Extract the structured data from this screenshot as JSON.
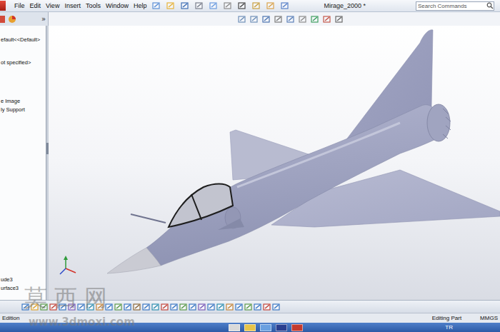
{
  "window": {
    "title": "Mirage_2000 *"
  },
  "menu": [
    "File",
    "Edit",
    "View",
    "Insert",
    "Tools",
    "Window",
    "Help"
  ],
  "search": {
    "placeholder": "Search Commands"
  },
  "panel": {
    "expand": "»"
  },
  "tree": {
    "groups": [
      [
        "efault<<Default>"
      ],
      [
        "ot specified>"
      ],
      [
        "e Image",
        "ly Support"
      ],
      [
        "ude3",
        "urface3"
      ]
    ]
  },
  "status_bar": {
    "left": "Edition",
    "mode": "Editing Part",
    "units": "MMGS"
  },
  "taskbar": {
    "language": "TR"
  },
  "watermark": {
    "title": "莫西网",
    "url": "www.3dmoxi.com"
  }
}
